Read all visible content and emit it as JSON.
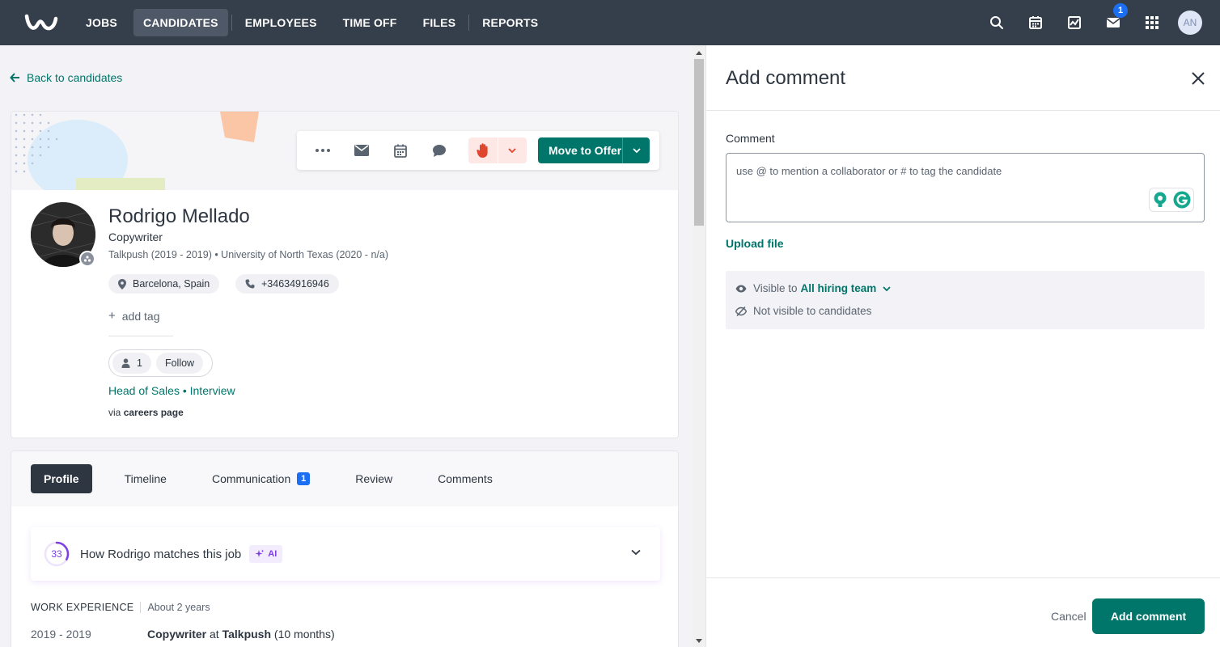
{
  "nav": {
    "items": [
      {
        "label": "JOBS",
        "active": false
      },
      {
        "label": "CANDIDATES",
        "active": true
      },
      {
        "label": "EMPLOYEES",
        "active": false
      },
      {
        "label": "TIME OFF",
        "active": false
      },
      {
        "label": "FILES",
        "active": false
      },
      {
        "label": "REPORTS",
        "active": false
      }
    ],
    "inbox_badge": "1",
    "user_initials": "AN",
    "icons": [
      "search-icon",
      "calendar-icon",
      "activity-icon",
      "inbox-icon",
      "apps-grid-icon"
    ]
  },
  "back_link": "Back to candidates",
  "actions": {
    "move_label": "Move to Offer"
  },
  "candidate": {
    "name": "Rodrigo Mellado",
    "title": "Copywriter",
    "history": "Talkpush (2019 - 2019) • University of North Texas (2020 - n/a)",
    "location": "Barcelona, Spain",
    "phone": "+34634916946",
    "add_tag": "add tag",
    "followers": "1",
    "follow_label": "Follow",
    "job": "Head of Sales • Interview",
    "via_prefix": "via",
    "via_source": "careers page"
  },
  "tabs": [
    {
      "label": "Profile",
      "active": true
    },
    {
      "label": "Timeline"
    },
    {
      "label": "Communication",
      "badge": "1"
    },
    {
      "label": "Review"
    },
    {
      "label": "Comments"
    }
  ],
  "match": {
    "score": "33",
    "score_fraction": 0.33,
    "title": "How Rodrigo matches this job",
    "ai_label": "AI"
  },
  "work": {
    "label": "WORK EXPERIENCE",
    "duration": "About 2 years",
    "years": "2019 - 2019",
    "role": "Copywriter",
    "at": "at",
    "company": "Talkpush",
    "length": "(10 months)"
  },
  "panel": {
    "title": "Add comment",
    "comment_label": "Comment",
    "comment_value": "",
    "comment_placeholder": "use @ to mention a collaborator or # to tag the candidate",
    "upload": "Upload file",
    "visible_prefix": "Visible to",
    "visible_team": "All hiring team",
    "not_visible": "Not visible to candidates",
    "cancel": "Cancel",
    "submit": "Add comment"
  },
  "colors": {
    "nav_bg": "#353e4b",
    "accent": "#00756a",
    "badge_blue": "#1c6ef2",
    "ai_purple": "#7b3fe4",
    "disqualify_red": "#e0452e"
  }
}
